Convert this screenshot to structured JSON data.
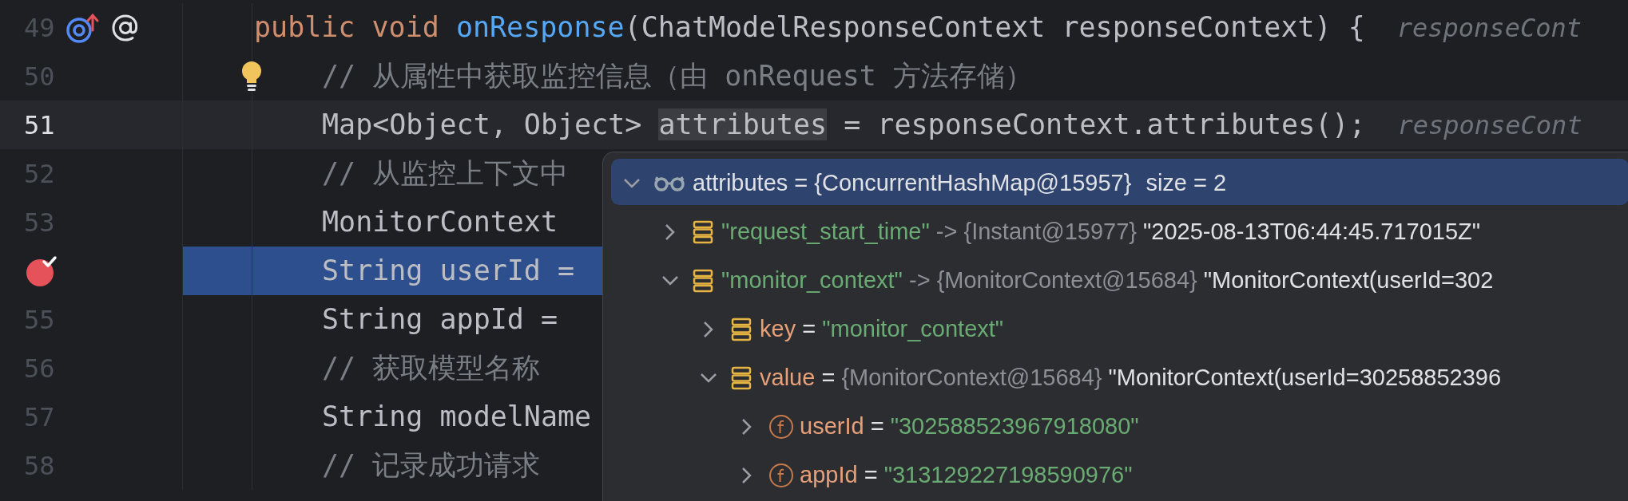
{
  "editor": {
    "lines": [
      {
        "number": "49",
        "current": false,
        "execution": false,
        "breakpoint": false,
        "overrides": true,
        "intention": false,
        "tokens": [
          {
            "kind": "keyword",
            "text": "public "
          },
          {
            "kind": "keyword",
            "text": "void "
          },
          {
            "kind": "method",
            "text": "onResponse"
          },
          {
            "kind": "plain",
            "text": "(ChatModelResponseContext responseContext) {"
          }
        ],
        "hint": "responseCont",
        "children": [
          {
            "number": "50",
            "current": false,
            "execution": false,
            "breakpoint": false,
            "overrides": false,
            "intention": true,
            "tokens": [
              {
                "kind": "comment",
                "text": "// 从属性中获取监控信息（由 onRequest 方法存储）"
              }
            ]
          },
          {
            "number": "51",
            "current": true,
            "execution": false,
            "breakpoint": false,
            "overrides": false,
            "intention": false,
            "tokens": [
              {
                "kind": "plain",
                "text": "Map<Object, Object> "
              },
              {
                "kind": "usage",
                "text": "attributes"
              },
              {
                "kind": "plain",
                "text": " = responseContext.attributes();"
              }
            ],
            "hint": "responseCont"
          },
          {
            "number": "52",
            "current": false,
            "execution": false,
            "breakpoint": false,
            "overrides": false,
            "intention": false,
            "tokens": [
              {
                "kind": "comment",
                "text": "// 从监控上下文中"
              }
            ]
          },
          {
            "number": "53",
            "current": false,
            "execution": false,
            "breakpoint": false,
            "overrides": false,
            "intention": false,
            "tokens": [
              {
                "kind": "plain",
                "text": "MonitorContext"
              }
            ]
          },
          {
            "current": false,
            "execution": true,
            "breakpoint": true,
            "overrides": false,
            "intention": false,
            "tokens": [
              {
                "kind": "plain",
                "text": "String userId ="
              }
            ]
          },
          {
            "number": "55",
            "current": false,
            "execution": false,
            "breakpoint": false,
            "overrides": false,
            "intention": false,
            "tokens": [
              {
                "kind": "plain",
                "text": "String appId ="
              }
            ]
          },
          {
            "number": "56",
            "current": false,
            "execution": false,
            "breakpoint": false,
            "overrides": false,
            "intention": false,
            "tokens": [
              {
                "kind": "comment",
                "text": "// 获取模型名称"
              }
            ]
          },
          {
            "number": "57",
            "current": false,
            "execution": false,
            "breakpoint": false,
            "overrides": false,
            "intention": false,
            "tokens": [
              {
                "kind": "plain",
                "text": "String modelName"
              }
            ]
          },
          {
            "number": "58",
            "current": false,
            "execution": false,
            "breakpoint": false,
            "overrides": false,
            "intention": false,
            "tokens": [
              {
                "kind": "comment",
                "text": "// 记录成功请求"
              }
            ]
          }
        ]
      }
    ]
  },
  "debug_popup": {
    "nodes": [
      {
        "kind": "watch",
        "name": "attributes",
        "separator": " = ",
        "type": "{ConcurrentHashMap@15957}",
        "value": "size = 2",
        "expanded": true,
        "children": [
          {
            "kind": "entry",
            "name": "\"request_start_time\"",
            "separator": " -> ",
            "type": "{Instant@15977}",
            "value": "\"2025-08-13T06:44:45.717015Z\"",
            "expanded": false
          },
          {
            "kind": "entry",
            "name": "\"monitor_context\"",
            "separator": " -> ",
            "type": "{MonitorContext@15684}",
            "value": "\"MonitorContext(userId=302",
            "expanded": true,
            "children": [
              {
                "kind": "field_entry",
                "name": "key",
                "separator": " = ",
                "value": "\"monitor_context\"",
                "expanded": false
              },
              {
                "kind": "field_entry",
                "name": "value",
                "separator": " = ",
                "type": "{MonitorContext@15684}",
                "value": "\"MonitorContext(userId=30258852396",
                "expanded": true,
                "children": [
                  {
                    "kind": "field",
                    "name": "userId",
                    "separator": " = ",
                    "value": "\"302588523967918080\"",
                    "expanded": false
                  },
                  {
                    "kind": "field",
                    "name": "appId",
                    "separator": " = ",
                    "value": "\"313129227198590976\"",
                    "expanded": false
                  }
                ]
              }
            ]
          }
        ]
      }
    ]
  }
}
